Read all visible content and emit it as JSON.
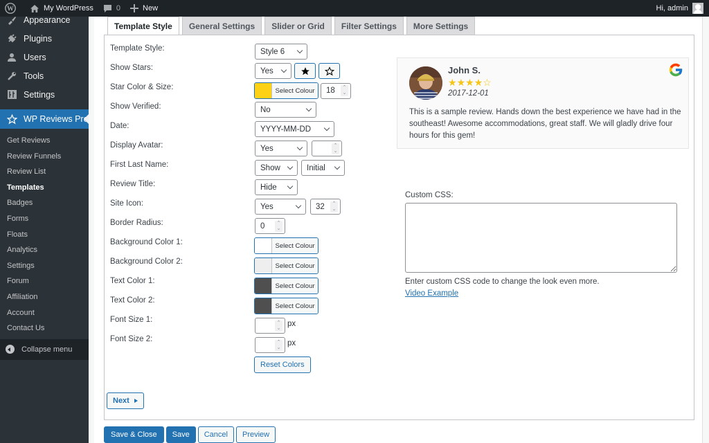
{
  "adminbar": {
    "site_name": "My WordPress",
    "comments_count": "0",
    "new_label": "New",
    "greeting": "Hi, admin"
  },
  "sidebar": {
    "menu": [
      {
        "label": "Appearance",
        "icon": "paintbrush-icon"
      },
      {
        "label": "Plugins",
        "icon": "plugin-icon"
      },
      {
        "label": "Users",
        "icon": "users-icon"
      },
      {
        "label": "Tools",
        "icon": "wrench-icon"
      },
      {
        "label": "Settings",
        "icon": "settings-icon"
      }
    ],
    "current": {
      "label": "WP Reviews Pro",
      "icon": "star-icon"
    },
    "submenu": [
      {
        "label": "Get Reviews"
      },
      {
        "label": "Review Funnels"
      },
      {
        "label": "Review List"
      },
      {
        "label": "Templates",
        "active": true
      },
      {
        "label": "Badges"
      },
      {
        "label": "Forms"
      },
      {
        "label": "Floats"
      },
      {
        "label": "Analytics"
      },
      {
        "label": "Settings"
      },
      {
        "label": "Forum"
      },
      {
        "label": "Affiliation"
      },
      {
        "label": "Account"
      },
      {
        "label": "Contact Us"
      }
    ],
    "collapse_label": "Collapse menu"
  },
  "tabs": [
    {
      "label": "Template Style",
      "active": true
    },
    {
      "label": "General Settings"
    },
    {
      "label": "Slider or Grid"
    },
    {
      "label": "Filter Settings"
    },
    {
      "label": "More Settings"
    }
  ],
  "form": {
    "labels": {
      "template_style": "Template Style:",
      "show_stars": "Show Stars:",
      "star_color_size": "Star Color & Size:",
      "show_verified": "Show Verified:",
      "date": "Date:",
      "display_avatar": "Display Avatar:",
      "first_last_name": "First Last Name:",
      "review_title": "Review Title:",
      "site_icon": "Site Icon:",
      "border_radius": "Border Radius:",
      "bg_color_1": "Background Color 1:",
      "bg_color_2": "Background Color 2:",
      "text_color_1": "Text Color 1:",
      "text_color_2": "Text Color 2:",
      "font_size_1": "Font Size 1:",
      "font_size_2": "Font Size 2:"
    },
    "values": {
      "template_style": "Style 6",
      "show_stars": "Yes",
      "star_size": "18",
      "show_verified": "No",
      "date_format": "YYYY-MM-DD",
      "display_avatar": "Yes",
      "avatar_size": "",
      "first_name": "Show",
      "last_name": "Initial",
      "review_title": "Hide",
      "site_icon": "Yes",
      "site_icon_size": "32",
      "border_radius": "0",
      "font_size_1": "",
      "font_size_2": ""
    },
    "colors": {
      "star_color": "#fcd116",
      "bg_color_1": "#ffffff",
      "bg_color_2": "#eeeeee",
      "text_color_1": "#4f4f4f",
      "text_color_2": "#4f4f4f"
    },
    "select_colour_label": "Select Colour",
    "px_unit": "px",
    "reset_colors_label": "Reset Colors",
    "next_label": "Next"
  },
  "preview": {
    "name": "John S.",
    "rating": 4,
    "max_rating": 5,
    "date": "2017-12-01",
    "text": "This is a sample review. Hands down the best experience we have had in the southeast! Awesome accommodations, great staff. We will gladly drive four hours for this gem!",
    "source_icon": "google-icon"
  },
  "custom_css": {
    "label": "Custom CSS:",
    "value": "",
    "help": "Enter custom CSS code to change the look even more.",
    "video_link": "Video Example"
  },
  "footer_buttons": {
    "save_close": "Save & Close",
    "save": "Save",
    "cancel": "Cancel",
    "preview": "Preview"
  },
  "theme": {
    "accent": "#2271b1",
    "adminbar_bg": "#1d2327",
    "sidebar_bg": "#2c3338",
    "star": "#f5c518"
  }
}
